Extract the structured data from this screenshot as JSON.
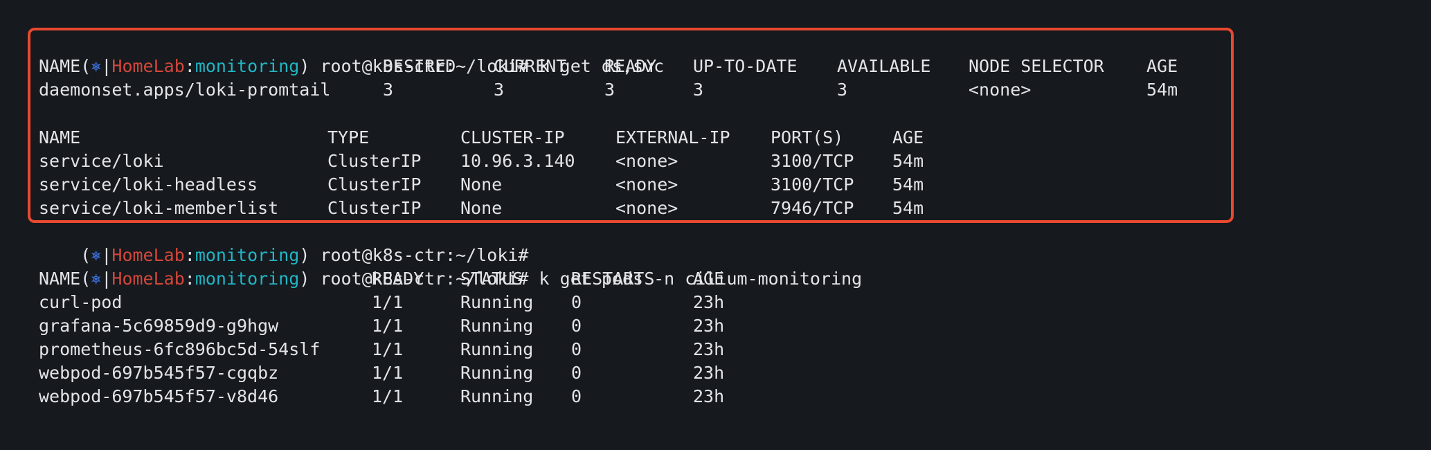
{
  "prompt": {
    "open": "(",
    "helm_icon": "⎈",
    "sep": "|",
    "context": "HomeLab",
    "colon": ":",
    "namespace": "monitoring",
    "close": ")",
    "user_path": " root@k8s-ctr:~/loki#"
  },
  "commands": {
    "first": " k get ds,svc",
    "second": "",
    "third": " k get pods -n cilium-monitoring",
    "fourth": " "
  },
  "daemonset_table": {
    "headers": [
      "NAME",
      "DESIRED",
      "CURRENT",
      "READY",
      "UP-TO-DATE",
      "AVAILABLE",
      "NODE SELECTOR",
      "AGE"
    ],
    "rows": [
      [
        "daemonset.apps/loki-promtail",
        "3",
        "3",
        "3",
        "3",
        "3",
        "<none>",
        "54m"
      ]
    ]
  },
  "service_table": {
    "headers": [
      "NAME",
      "TYPE",
      "CLUSTER-IP",
      "EXTERNAL-IP",
      "PORT(S)",
      "AGE"
    ],
    "rows": [
      [
        "service/loki",
        "ClusterIP",
        "10.96.3.140",
        "<none>",
        "3100/TCP",
        "54m"
      ],
      [
        "service/loki-headless",
        "ClusterIP",
        "None",
        "<none>",
        "3100/TCP",
        "54m"
      ],
      [
        "service/loki-memberlist",
        "ClusterIP",
        "None",
        "<none>",
        "7946/TCP",
        "54m"
      ]
    ]
  },
  "pods_table": {
    "headers": [
      "NAME",
      "READY",
      "STATUS",
      "RESTARTS",
      "AGE"
    ],
    "rows": [
      [
        "curl-pod",
        "1/1",
        "Running",
        "0",
        "23h"
      ],
      [
        "grafana-5c69859d9-g9hgw",
        "1/1",
        "Running",
        "0",
        "23h"
      ],
      [
        "prometheus-6fc896bc5d-54slf",
        "1/1",
        "Running",
        "0",
        "23h"
      ],
      [
        "webpod-697b545f57-cgqbz",
        "1/1",
        "Running",
        "0",
        "23h"
      ],
      [
        "webpod-697b545f57-v8d46",
        "1/1",
        "Running",
        "0",
        "23h"
      ]
    ]
  },
  "colors": {
    "background": "#16191e",
    "foreground": "#e3e4e6",
    "helm_icon": "#3b6fd9",
    "context": "#d2473a",
    "namespace": "#21b6c4",
    "highlight_border": "#e8492f"
  }
}
